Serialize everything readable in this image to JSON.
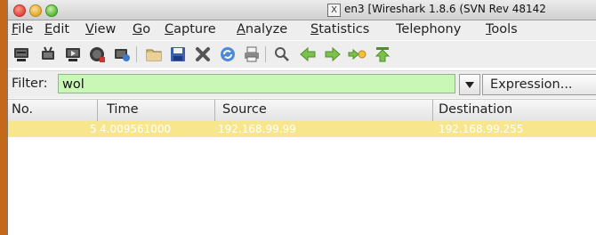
{
  "window": {
    "title_icon_glyph": "X",
    "title": "en3  [Wireshark 1.8.6  (SVN Rev 48142"
  },
  "menu": {
    "items": [
      {
        "u": "F",
        "rest": "ile"
      },
      {
        "u": "E",
        "rest": "dit"
      },
      {
        "u": "V",
        "rest": "iew"
      },
      {
        "u": "G",
        "rest": "o"
      },
      {
        "u": "C",
        "rest": "apture"
      },
      {
        "u": "A",
        "rest": "nalyze"
      },
      {
        "u": "S",
        "rest": "tatistics"
      },
      {
        "u": "",
        "rest": "Telephony"
      },
      {
        "u": "T",
        "rest": "ools"
      }
    ]
  },
  "toolbar": {
    "icons": [
      "interfaces-icon",
      "options-icon",
      "start-capture-icon",
      "stop-capture-icon",
      "restart-capture-icon",
      "open-file-icon",
      "save-file-icon",
      "close-file-icon",
      "reload-icon",
      "print-icon",
      "find-icon",
      "back-icon",
      "forward-icon",
      "goto-icon",
      "first-packet-icon"
    ]
  },
  "filter": {
    "label": "Filter:",
    "value": "wol",
    "expression_label": "Expression..."
  },
  "packet_list": {
    "columns": [
      "No.",
      "Time",
      "Source",
      "Destination"
    ],
    "rows": [
      {
        "no": "5",
        "time": "4.009561000",
        "source": "192.168.99.99",
        "destination": "192.168.99.255"
      }
    ],
    "row_color": "#f8e68c"
  }
}
